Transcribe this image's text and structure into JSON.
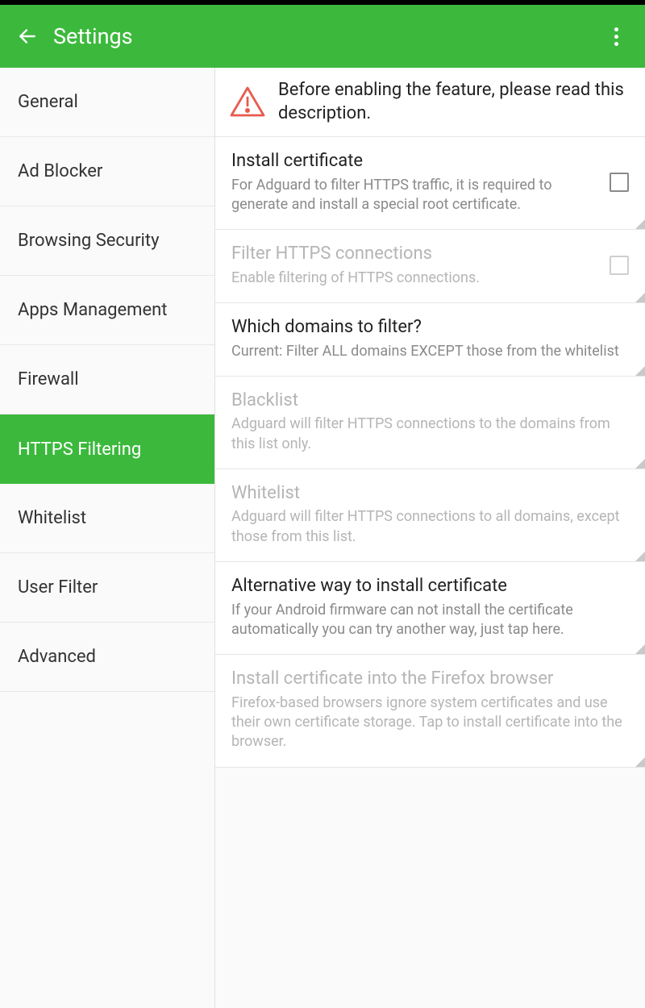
{
  "header": {
    "title": "Settings"
  },
  "sidebar": {
    "items": [
      {
        "label": "General"
      },
      {
        "label": "Ad Blocker"
      },
      {
        "label": "Browsing Security"
      },
      {
        "label": "Apps Management"
      },
      {
        "label": "Firewall"
      },
      {
        "label": "HTTPS Filtering"
      },
      {
        "label": "Whitelist"
      },
      {
        "label": "User Filter"
      },
      {
        "label": "Advanced"
      }
    ]
  },
  "warning": {
    "text": "Before enabling the feature, please read this description."
  },
  "settings": {
    "install_cert": {
      "title": "Install certificate",
      "desc": "For Adguard to filter HTTPS traffic, it is required to generate and install a special root certificate."
    },
    "filter_https": {
      "title": "Filter HTTPS connections",
      "desc": "Enable filtering of HTTPS connections."
    },
    "which_domains": {
      "title": "Which domains to filter?",
      "desc": "Current: Filter ALL domains EXCEPT those from the whitelist"
    },
    "blacklist": {
      "title": "Blacklist",
      "desc": "Adguard will filter HTTPS connections to the domains from this list only."
    },
    "whitelist": {
      "title": "Whitelist",
      "desc": "Adguard will filter HTTPS connections to all domains, except those from this list."
    },
    "alt_install": {
      "title": "Alternative way to install certificate",
      "desc": "If your Android firmware can not install the certificate automatically you can try another way, just tap here."
    },
    "firefox": {
      "title": "Install certificate into the Firefox browser",
      "desc": "Firefox-based browsers ignore system certificates and use their own certificate storage. Tap to install certificate into the browser."
    }
  }
}
